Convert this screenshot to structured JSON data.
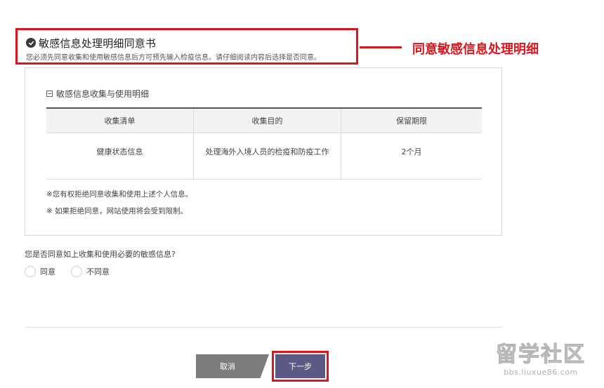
{
  "consent": {
    "title": "敏感信息处理明细同意书",
    "subtitle": "您必须先同意收集和使用敏感信息后方可预先输入检疫信息。请仔细阅读内容后选择是否同意。",
    "annotation": "同意敏感信息处理明细"
  },
  "panel": {
    "heading": "敏感信息收集与使用明细",
    "table": {
      "columns": [
        "收集清单",
        "收集目的",
        "保留期限"
      ],
      "rows": [
        [
          "健康状态信息",
          "处理海外入境人员的检疫和防疫工作",
          "2个月"
        ]
      ]
    },
    "notes": [
      "※您有权拒绝同意收集和使用上述个人信息。",
      "※ 如果拒绝同意，网站使用将会受到限制。"
    ]
  },
  "question": {
    "text": "您是否同意如上收集和使用必要的敏感信息?",
    "options": [
      "同意",
      "不同意"
    ]
  },
  "buttons": {
    "cancel": "取消",
    "next": "下一步"
  },
  "watermark": {
    "logo": "留学社区",
    "url": "bbs.liuxue86.com"
  },
  "colors": {
    "highlight": "#d7161e",
    "next_button": "#5c5a84",
    "cancel_button": "#7c7c7c"
  }
}
